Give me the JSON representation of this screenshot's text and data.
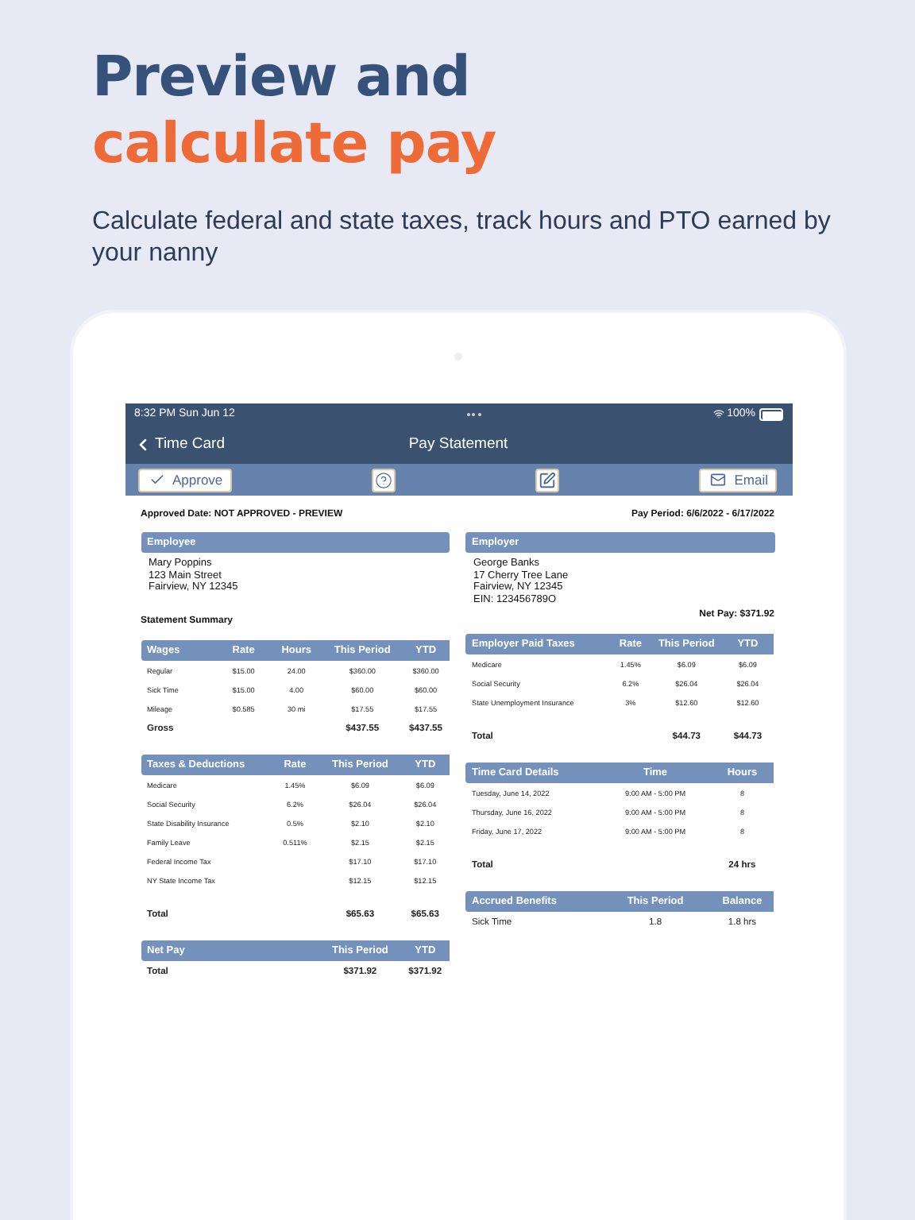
{
  "headline": {
    "line_1": "Preview and",
    "line_2": "calculate pay"
  },
  "subtitle": "Calculate federal and state taxes, track hours and PTO earned by your nanny",
  "status_bar": {
    "time": "8:32 PM  Sun Jun 12",
    "battery": "100%"
  },
  "nav_bar": {
    "back": "Time Card",
    "title": "Pay Statement"
  },
  "toolbar": {
    "approve": "Approve",
    "email": "Email"
  },
  "approved_date": "Approved Date: NOT APPROVED - PREVIEW",
  "pay_period": "Pay Period: 6/6/2022 - 6/17/2022",
  "employee": {
    "title": "Employee",
    "lines": [
      "Mary Poppins",
      "123 Main Street",
      "Fairview, NY 12345"
    ]
  },
  "employer": {
    "title": "Employer",
    "lines": [
      "George Banks",
      "17 Cherry Tree Lane",
      "Fairview, NY 12345",
      "EIN: 123456789O"
    ]
  },
  "statement_summary": "Statement Summary",
  "net_pay": "Net Pay: $371.92",
  "left_tables": [
    {
      "columns": [
        "Wages",
        "Rate",
        "Hours",
        "This Period",
        "YTD"
      ],
      "rows": [
        {
          "kind": "item",
          "cells": [
            "Regular",
            "$15.00",
            "24.00",
            "$360.00",
            "$360.00"
          ]
        },
        {
          "kind": "item",
          "cells": [
            "Sick Time",
            "$15.00",
            "4.00",
            "$60.00",
            "$60.00"
          ]
        },
        {
          "kind": "item",
          "cells": [
            "Mileage",
            "$0.585",
            "30 mi",
            "$17.55",
            "$17.55"
          ]
        },
        {
          "kind": "sum",
          "cells": [
            "Gross",
            null,
            null,
            "$437.55",
            "$437.55"
          ]
        }
      ]
    },
    {
      "columns": [
        "Taxes & Deductions",
        "Rate",
        "This Period",
        "YTD"
      ],
      "rows": [
        {
          "kind": "item",
          "cells": [
            "Medicare",
            "1.45%",
            "$6.09",
            "$6.09"
          ]
        },
        {
          "kind": "item",
          "cells": [
            "Social Security",
            "6.2%",
            "$26.04",
            "$26.04"
          ]
        },
        {
          "kind": "item",
          "cells": [
            "State Disability Insurance",
            "0.5%",
            "$2.10",
            "$2.10"
          ]
        },
        {
          "kind": "item",
          "cells": [
            "Family Leave",
            "0.511%",
            "$2.15",
            "$2.15"
          ]
        },
        {
          "kind": "item",
          "cells": [
            "Federal Income Tax",
            null,
            "$17.10",
            "$17.10"
          ]
        },
        {
          "kind": "item",
          "cells": [
            "NY State Income Tax",
            null,
            "$12.15",
            "$12.15"
          ]
        },
        {
          "kind": "total",
          "cells": [
            "Total",
            null,
            "$65.63",
            "$65.63"
          ]
        }
      ]
    },
    {
      "columns": [
        "Net Pay",
        "This Period",
        "YTD"
      ],
      "rows": [
        {
          "kind": "sum",
          "cells": [
            "Total",
            "$371.92",
            "$371.92"
          ]
        }
      ]
    }
  ],
  "right_tables": [
    {
      "columns": [
        "Employer Paid Taxes",
        "Rate",
        "This Period",
        "YTD"
      ],
      "rows": [
        {
          "kind": "item",
          "cells": [
            "Medicare",
            "1.45%",
            "$6.09",
            "$6.09"
          ]
        },
        {
          "kind": "item",
          "cells": [
            "Social Security",
            "6.2%",
            "$26.04",
            "$26.04"
          ]
        },
        {
          "kind": "item",
          "cells": [
            "State Unemployment Insurance",
            "3%",
            "$12.60",
            "$12.60"
          ]
        },
        {
          "kind": "total",
          "cells": [
            "Total",
            null,
            "$44.73",
            "$44.73"
          ]
        }
      ]
    },
    {
      "columns": [
        "Time Card Details",
        "Time",
        "Hours"
      ],
      "rows": [
        {
          "kind": "item",
          "cells": [
            "Tuesday, June 14, 2022",
            "9:00 AM - 5:00 PM",
            "8"
          ]
        },
        {
          "kind": "item",
          "cells": [
            "Thursday, June 16, 2022",
            "9:00 AM - 5:00 PM",
            "8"
          ]
        },
        {
          "kind": "item",
          "cells": [
            "Friday, June 17, 2022",
            "9:00 AM - 5:00 PM",
            "8"
          ]
        },
        {
          "kind": "total",
          "cells": [
            "Total",
            null,
            "24 hrs"
          ]
        }
      ]
    },
    {
      "columns": [
        "Accrued Benefits",
        "This Period",
        "Balance"
      ],
      "rows": [
        {
          "kind": "large",
          "cells": [
            "Sick Time",
            "1.8",
            "1.8 hrs"
          ]
        }
      ]
    }
  ]
}
